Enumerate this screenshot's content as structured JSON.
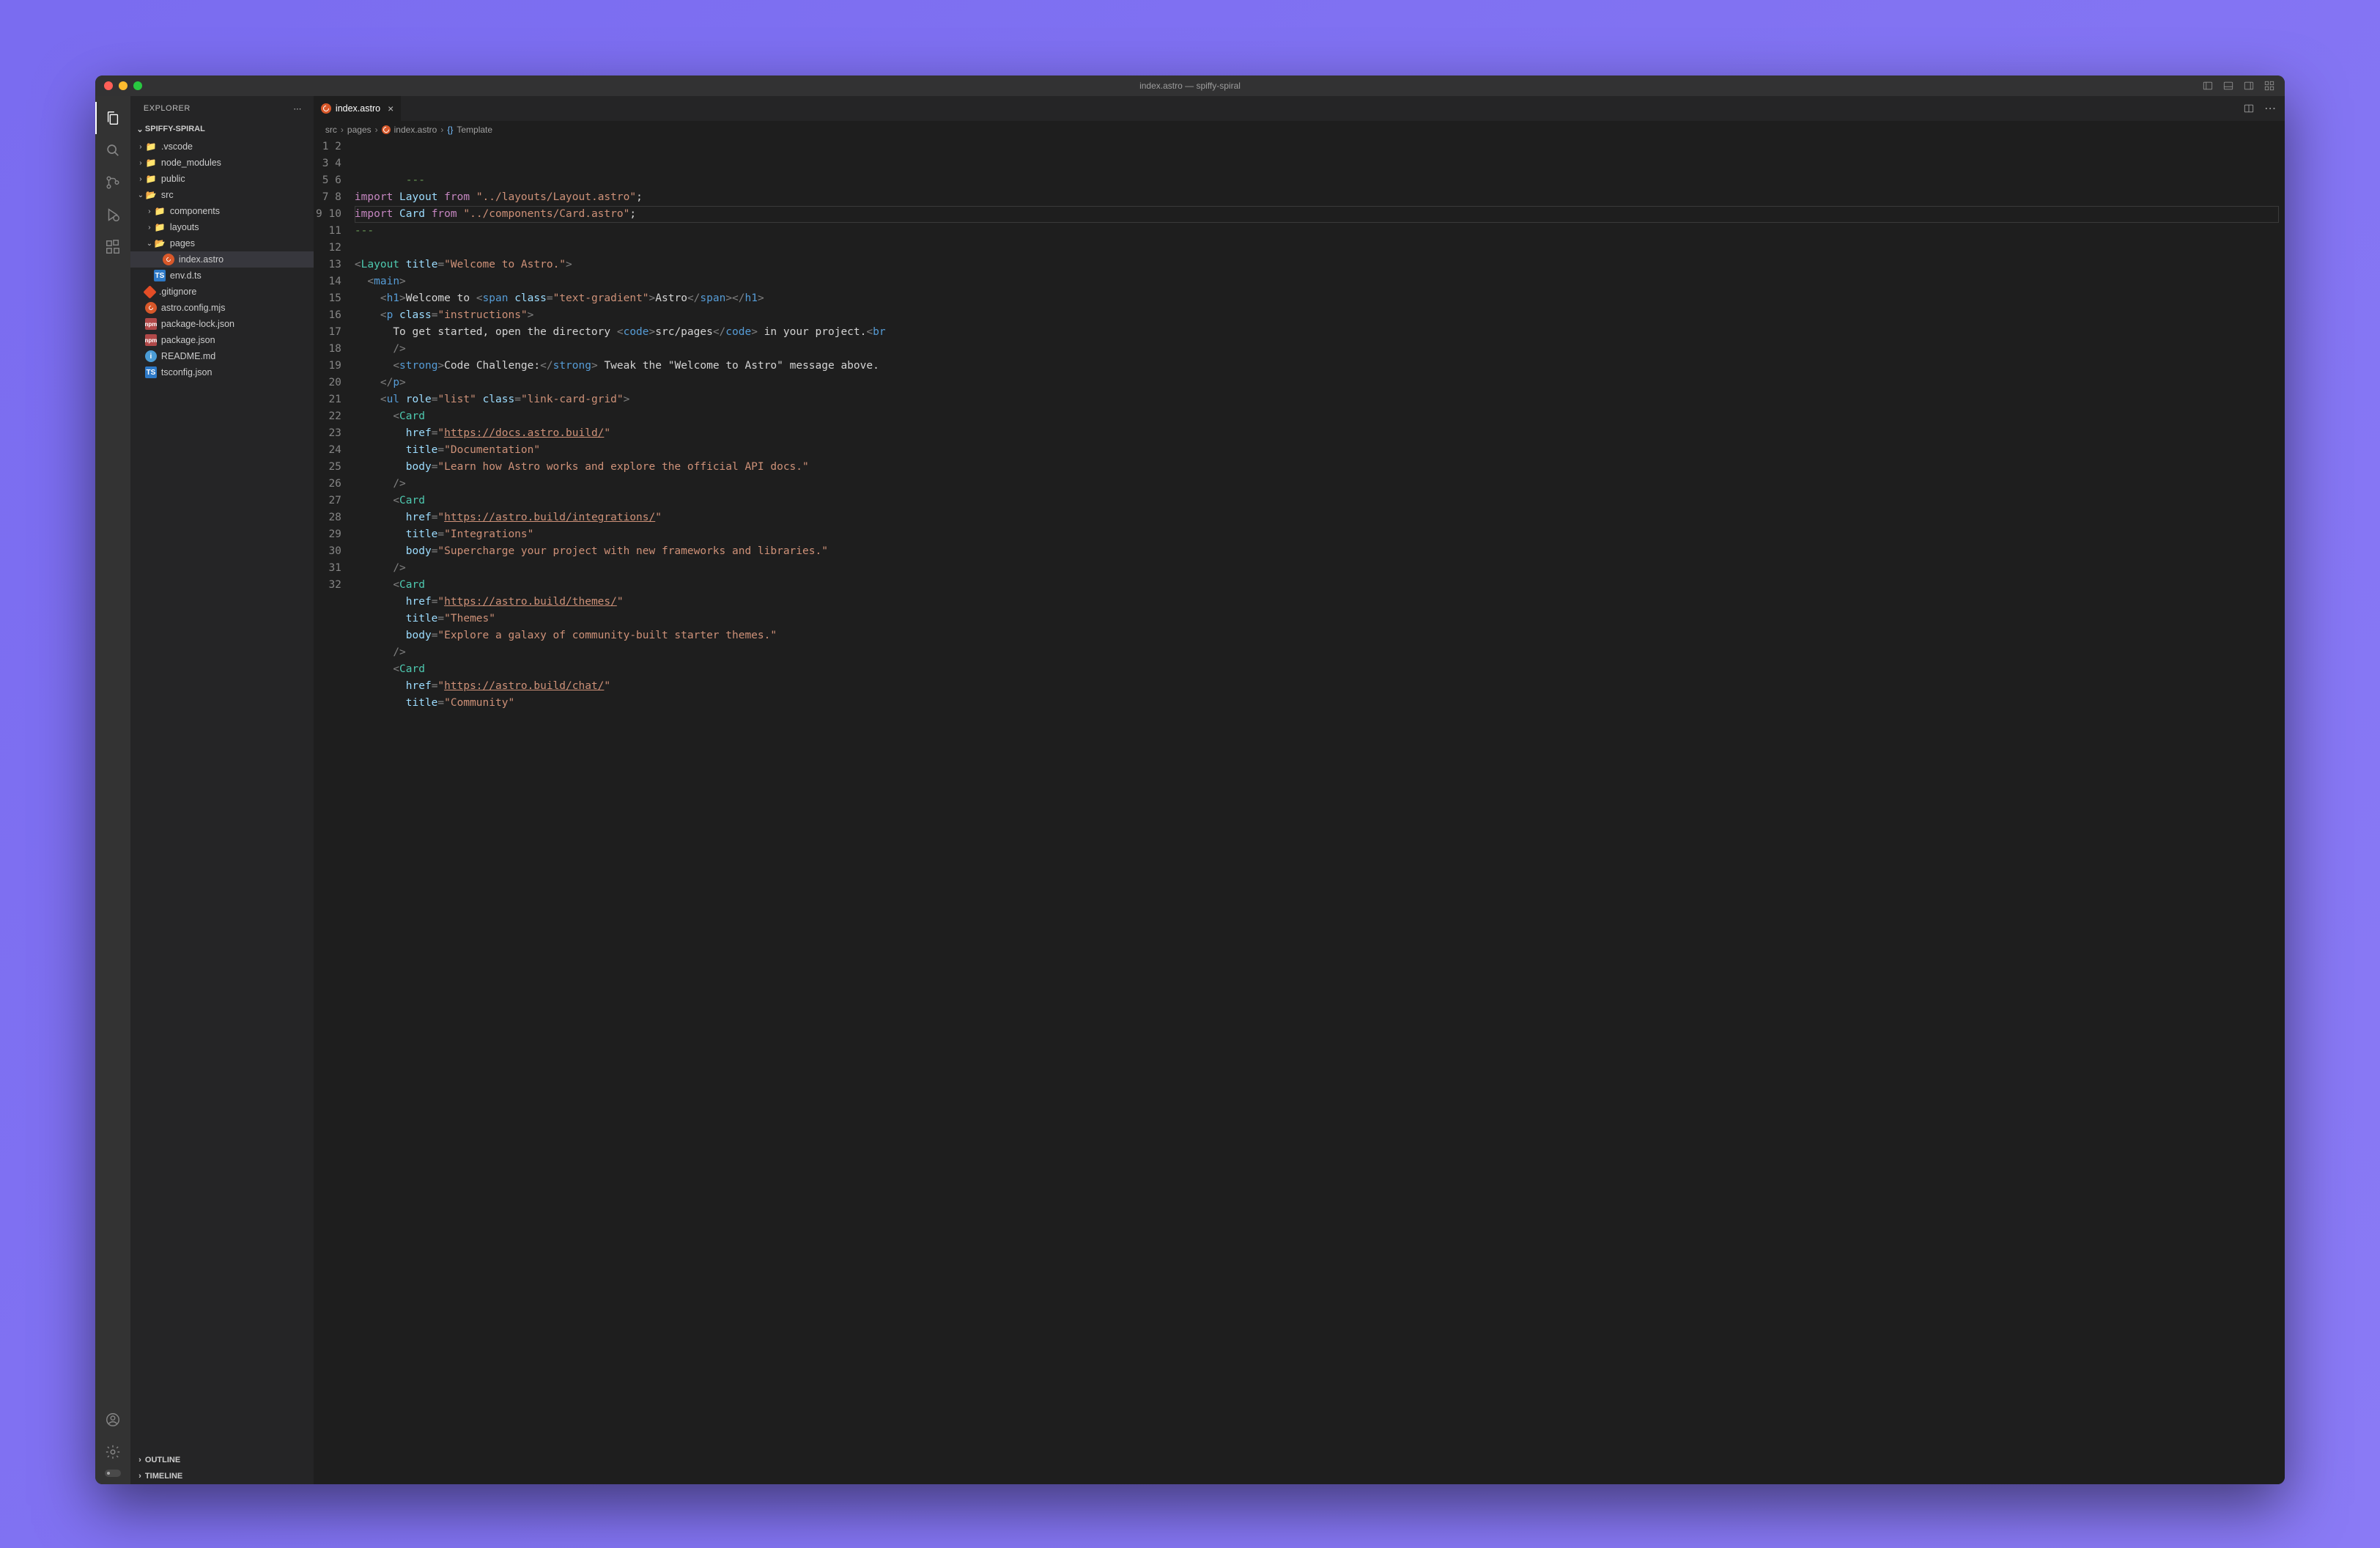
{
  "window": {
    "title": "index.astro — spiffy-spiral"
  },
  "sidebar": {
    "header": "EXPLORER",
    "project": "SPIFFY-SPIRAL",
    "bottom1": "OUTLINE",
    "bottom2": "TIMELINE"
  },
  "tree": [
    {
      "depth": 0,
      "kind": "folder",
      "open": false,
      "label": ".vscode",
      "color": "#3a8fd6"
    },
    {
      "depth": 0,
      "kind": "folder",
      "open": false,
      "label": "node_modules",
      "color": "#6a9955"
    },
    {
      "depth": 0,
      "kind": "folder",
      "open": false,
      "label": "public",
      "color": "#c09553"
    },
    {
      "depth": 0,
      "kind": "folder",
      "open": true,
      "label": "src",
      "color": "#6a9955"
    },
    {
      "depth": 1,
      "kind": "folder",
      "open": false,
      "label": "components",
      "color": "#c09553"
    },
    {
      "depth": 1,
      "kind": "folder",
      "open": false,
      "label": "layouts",
      "color": "#c09553"
    },
    {
      "depth": 1,
      "kind": "folder",
      "open": true,
      "label": "pages",
      "color": "#c09553"
    },
    {
      "depth": 2,
      "kind": "file",
      "label": "index.astro",
      "badge": "",
      "color": "#d8582a",
      "sel": true,
      "astro": true
    },
    {
      "depth": 1,
      "kind": "file",
      "label": "env.d.ts",
      "badge": "TS",
      "color": "#2d79c7"
    },
    {
      "depth": 0,
      "kind": "file",
      "label": ".gitignore",
      "badge": "",
      "color": "#e44d26",
      "git": true
    },
    {
      "depth": 0,
      "kind": "file",
      "label": "astro.config.mjs",
      "badge": "",
      "color": "#d8582a",
      "astro": true
    },
    {
      "depth": 0,
      "kind": "file",
      "label": "package-lock.json",
      "badge": "",
      "color": "#b04848",
      "npm": true
    },
    {
      "depth": 0,
      "kind": "file",
      "label": "package.json",
      "badge": "",
      "color": "#b04848",
      "npm": true
    },
    {
      "depth": 0,
      "kind": "file",
      "label": "README.md",
      "badge": "",
      "color": "#4a9cd6",
      "info": true
    },
    {
      "depth": 0,
      "kind": "file",
      "label": "tsconfig.json",
      "badge": "TS",
      "color": "#2d79c7"
    }
  ],
  "tab": {
    "label": "index.astro"
  },
  "breadcrumbs": {
    "a": "src",
    "b": "pages",
    "c": "index.astro",
    "d": "Template"
  },
  "code": {
    "lines": 32,
    "l2": {
      "kw1": "import",
      "id": "Layout",
      "kw2": "from",
      "str": "\"../layouts/Layout.astro\""
    },
    "l3": {
      "kw1": "import",
      "id": "Card",
      "kw2": "from",
      "str": "\"../components/Card.astro\""
    },
    "l6": {
      "tag": "Layout",
      "attr": "title",
      "val": "\"Welcome to Astro.\""
    },
    "l7": {
      "tag": "main"
    },
    "l8": {
      "tag": "h1",
      "txt1": "Welcome to ",
      "tag2": "span",
      "attr": "class",
      "val": "\"text-gradient\"",
      "txt2": "Astro"
    },
    "l9": {
      "tag": "p",
      "attr": "class",
      "val": "\"instructions\""
    },
    "l10": {
      "txt1": "To get started, open the directory ",
      "tag": "code",
      "txt2": "src/pages",
      "txt3": " in your project.",
      "tag2": "br"
    },
    "l12": {
      "tag": "strong",
      "txt1": "Code Challenge:",
      "txt2": " Tweak the \"Welcome to Astro\" message above."
    },
    "l14": {
      "tag": "ul",
      "attr1": "role",
      "val1": "\"list\"",
      "attr2": "class",
      "val2": "\"link-card-grid\""
    },
    "card1": {
      "href": "https://docs.astro.build/",
      "title": "Documentation",
      "body": "Learn how Astro works and explore the official API docs."
    },
    "card2": {
      "href": "https://astro.build/integrations/",
      "title": "Integrations",
      "body": "Supercharge your project with new frameworks and libraries."
    },
    "card3": {
      "href": "https://astro.build/themes/",
      "title": "Themes",
      "body": "Explore a galaxy of community-built starter themes."
    },
    "card4": {
      "href": "https://astro.build/chat/",
      "title": "Community"
    }
  }
}
